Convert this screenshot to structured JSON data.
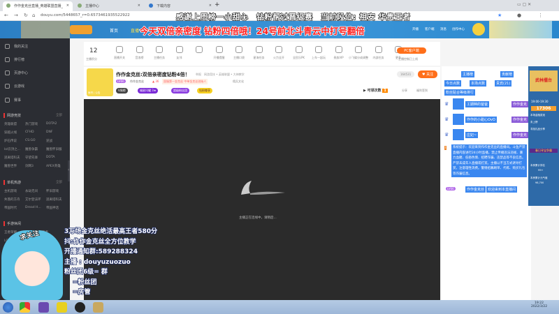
{
  "browser": {
    "tabs": [
      {
        "title": "作作金克丝直播_英雄联盟直播_"
      },
      {
        "title": "主播中心"
      },
      {
        "title": "下载内容"
      }
    ],
    "url": "douyu.com/5448657_r=0.6573461935522922"
  },
  "stream_banner": "感谢上周榜一小甜心　钻粉帮过晋级赛　当前段位: 祖安 华贵王者",
  "header": {
    "nav": [
      "首页",
      "直播",
      "分类"
    ],
    "promo": "今天双倍亲密度 钻粉四倍哦！24号前北斗青云中打号翻倍",
    "right_icons": [
      "开播",
      "客户端",
      "消息",
      "创作中心"
    ]
  },
  "sidebar": {
    "items": [
      "我的关注",
      "排行榜",
      "页游中心",
      "云游戏",
      "赛事"
    ],
    "sections": [
      {
        "title": "网游竞技",
        "more": "全部",
        "games": [
          "英雄联盟",
          "热门游戏",
          "DOTA2",
          "穿越火线",
          "CFHD",
          "DNF",
          "炉石传说",
          "CS:GO",
          "逆战",
          "lol云顶之...",
          "魔兽争霸",
          "魔兽怀旧服",
          "逃离塔科夫",
          "守望先锋",
          "DOTA",
          "魔兽世界",
          "剑网3",
          "APEX英雄"
        ]
      },
      {
        "title": "单机热游",
        "more": "全部",
        "games": [
          "主机游戏",
          "永劫无间",
          "怀旧游戏",
          "失落的方舟",
          "艾尔登法环",
          "逃离塔科夫",
          "帝国时代",
          "Dread H...",
          "帝国神话"
        ]
      },
      {
        "title": "手游休闲",
        "games": [
          "王者荣耀",
          "火影忍者",
          "LOL手游",
          "CF手游"
        ]
      }
    ]
  },
  "toolbar": {
    "score": "12",
    "score_label": "主播积分",
    "items": [
      "直播开关",
      "音浪榜",
      "主播任务",
      "友邻",
      "",
      "开播提醒",
      "主播口袋",
      "星海任务",
      "火力全开",
      "全民乐PK",
      "上车一起玩",
      "贵族VIP",
      "小飞碟分成调整",
      "内部任务",
      "更多"
    ],
    "pc_client": "PC客户端",
    "pc_sub": "主播控制已上线"
  },
  "room": {
    "title": "作作金克丝:双倍亲密度钻粉4倍！",
    "tags": "举报　网游竞技 • 英雄联盟 • 大神教学",
    "level": "LV66",
    "name": "作作金克丝",
    "hot": "36",
    "badge": "国服第一金克丝 中单金克丝创始人",
    "note": "佣兵文化",
    "follow_count": "164531",
    "follow": "关注",
    "chips": [
      "V周榜",
      "福星闪耀 3★",
      "超级粉丝团",
      "钻粉尊享"
    ],
    "avatar_caption": "鱼吧 | 公告",
    "redeem": "可领次数",
    "redeem_count": "1",
    "share": "分享",
    "sign": "福利签到"
  },
  "video": {
    "status": "主播正在连线中，请稍后..."
  },
  "right": {
    "tabs": [
      "主播榜",
      "贡献榜"
    ],
    "sub": [
      "今日点数",
      "本场点数",
      "贵宾(21)"
    ],
    "rank_title": "粉丝贴合等级排行",
    "fans": [
      "工期种的爸爸",
      "作作的小甜心OvO",
      "庄妃~"
    ],
    "fan_badge": "作作金克",
    "sys_msg": "系统提示：欢迎来到作作金克丝的直播间。斗鱼严禁直播内容进行24小时监播，禁止传播违法违规、暴力血腥、低俗色情、招聘诈骗、违禁品等不良信息。严禁未成年人直播或打赏。主播以不当方式诱导打赏，注意理性消费。警惕招募刷单、代练、购买礼包等诈骗信息。",
    "chat": {
      "level": "LV66",
      "user": "作作金克丝",
      "msg": "欢迎来到本直播间"
    }
  },
  "ad": {
    "title": "武林擂台",
    "time": "19:00-19:30",
    "num": "17306",
    "l1": "本场金融奖池",
    "l2": "主播排名",
    "l3": "未上榜",
    "l4": "寻找礼品分享",
    "t2": "春日寻宝争霸",
    "c1": "本房累计排名",
    "c2": "99+",
    "c3": "本房累计元气值",
    "c4": "98,700"
  },
  "overlay": {
    "lines": [
      "3万场金克丝绝活最高王者580分",
      "抖:作作金克丝全方位教学",
      "开播通知群:589288324",
      "主播 : douyuzuozuo",
      "粉丝团6级= 群",
      "=粉丝团",
      "=房管"
    ],
    "sticker": "求关注"
  },
  "taskbar": {
    "time": "19:22",
    "date": "2022/3/22"
  },
  "colors": {
    "douyu_blue": "#2f8ad6",
    "orange": "#ff6f1a",
    "sidebar": "#2b2d33",
    "highlight": "#3a87f0"
  }
}
